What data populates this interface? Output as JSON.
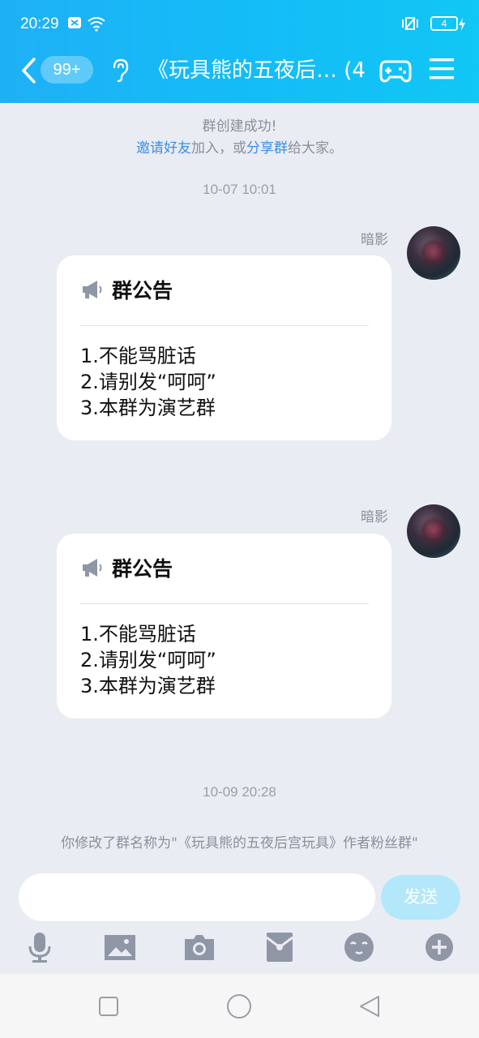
{
  "status": {
    "time": "20:29",
    "battery": "4"
  },
  "header": {
    "badge": "99+",
    "title": "《玩具熊的五夜后… (4)"
  },
  "system_notice": {
    "line1": "群创建成功!",
    "invite_link": "邀请好友",
    "middle_text": "加入，或",
    "share_link": "分享群",
    "end_text": "给大家。"
  },
  "messages": [
    {
      "timestamp": "10-07 10:01",
      "sender": "暗影",
      "card_title": "群公告",
      "lines": [
        "1.不能骂脏话",
        "2.请别发“呵呵”",
        "3.本群为演艺群"
      ]
    },
    {
      "sender": "暗影",
      "card_title": "群公告",
      "lines": [
        "1.不能骂脏话",
        "2.请别发“呵呵”",
        "3.本群为演艺群"
      ]
    }
  ],
  "timestamp2": "10-09 20:28",
  "rename_notice": "你修改了群名称为\"《玩具熊的五夜后宫玩具》作者粉丝群\"",
  "input": {
    "value": "",
    "send_label": "发送"
  },
  "toolbar": {
    "icons": [
      "microphone-icon",
      "image-icon",
      "camera-icon",
      "red-packet-icon",
      "emoji-icon",
      "plus-icon"
    ]
  },
  "colors": {
    "header_start": "#1fb0f6",
    "header_end": "#11c7f5",
    "link": "#3a8fe8",
    "send_button": "#b3e8fb",
    "icon_gray": "#8f96a6"
  }
}
